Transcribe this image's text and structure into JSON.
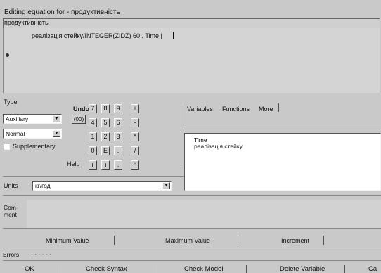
{
  "window": {
    "title": "Editing equation for - продуктивність"
  },
  "equation": {
    "variable_name": "продуктивність",
    "text": "реалізація стейку/INTEGER(ZIDZ) 60 . Time |"
  },
  "type": {
    "label": "Type",
    "selected": "Auxiliary",
    "subtype_selected": "Normal",
    "supplementary_label": "Supplementary",
    "supplementary_checked": false
  },
  "undo": {
    "label": "Undo",
    "button": "(00)"
  },
  "help": {
    "label": "Help"
  },
  "keypad": [
    [
      "7",
      "8",
      "9",
      "+"
    ],
    [
      "4",
      "5",
      "6",
      "-"
    ],
    [
      "1",
      "2",
      "3",
      "*"
    ],
    [
      "0",
      "E",
      ".",
      "/"
    ],
    [
      "(",
      ")",
      ",",
      "^"
    ]
  ],
  "tabs": [
    "Variables",
    "Functions",
    "More"
  ],
  "variables": [
    "Time",
    "реалізація стейку"
  ],
  "units": {
    "label": "Units",
    "value": "кг/год"
  },
  "comment": {
    "label": "Com-\nment"
  },
  "range": {
    "min_label": "Minimum Value",
    "max_label": "Maximum Value",
    "inc_label": "Increment"
  },
  "errors": {
    "label": "Errors",
    "value": "· · · · · ·"
  },
  "buttons": {
    "ok": "OK",
    "check_syntax": "Check Syntax",
    "check_model": "Check Model",
    "delete_variable": "Delete Variable",
    "cancel": "Ca"
  }
}
